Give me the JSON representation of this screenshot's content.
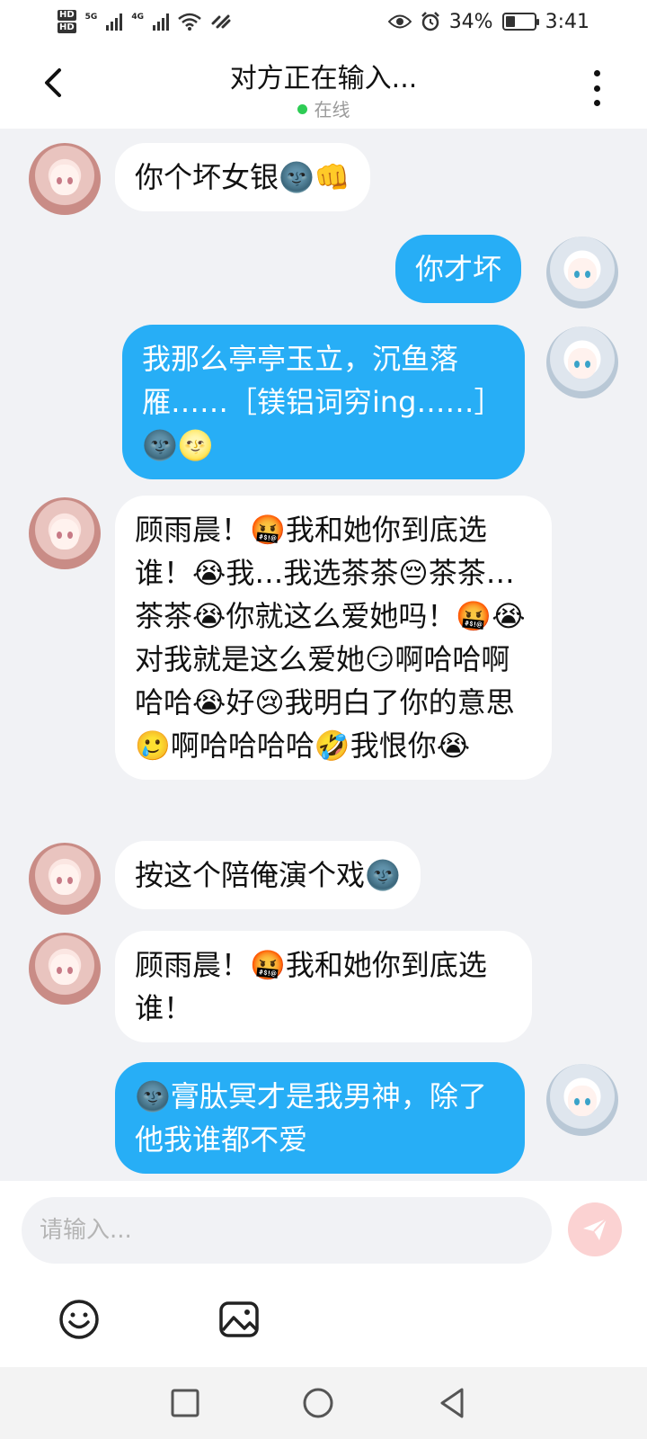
{
  "status_bar": {
    "network_badge_1": "HD",
    "network_badge_2": "HD",
    "network_type_1": "5G",
    "network_type_2": "4G",
    "battery_percent": "34%",
    "battery_level": 0.34,
    "time": "3:41"
  },
  "header": {
    "title": "对方正在输入...",
    "status": "在线",
    "status_color": "#2ecc55"
  },
  "messages": [
    {
      "sender": "other",
      "text": "你个坏女银🌚👊"
    },
    {
      "sender": "me",
      "text": "你才坏"
    },
    {
      "sender": "me",
      "text": "我那么亭亭玉立，沉鱼落雁……［镁铝词穷ing……］🌚🌝"
    },
    {
      "sender": "other",
      "text": "顾雨晨！🤬我和她你到底选谁！😭我…我选茶茶😔茶茶…茶茶😭你就这么爱她吗！🤬😭对我就是这么爱她😏啊哈哈啊哈哈😭好😢我明白了你的意思🥲啊哈哈哈哈🤣我恨你😭"
    },
    {
      "sender": "other",
      "text": "按这个陪俺演个戏🌚"
    },
    {
      "sender": "other",
      "text": "顾雨晨！🤬我和她你到底选谁！"
    },
    {
      "sender": "me",
      "text": "🌚膏肽冥才是我男神，除了他我谁都不爱"
    }
  ],
  "composer": {
    "placeholder": "请输入...",
    "send_icon": "send-icon",
    "emoji_icon": "emoji-icon",
    "image_icon": "image-icon"
  },
  "colors": {
    "outgoing_bubble": "#27aef6",
    "incoming_bubble": "#ffffff",
    "chat_background": "#f1f2f5",
    "send_button": "#fbd2d2"
  },
  "nav_bar": {
    "recent_icon": "square-icon",
    "home_icon": "circle-icon",
    "back_icon": "triangle-back-icon"
  }
}
